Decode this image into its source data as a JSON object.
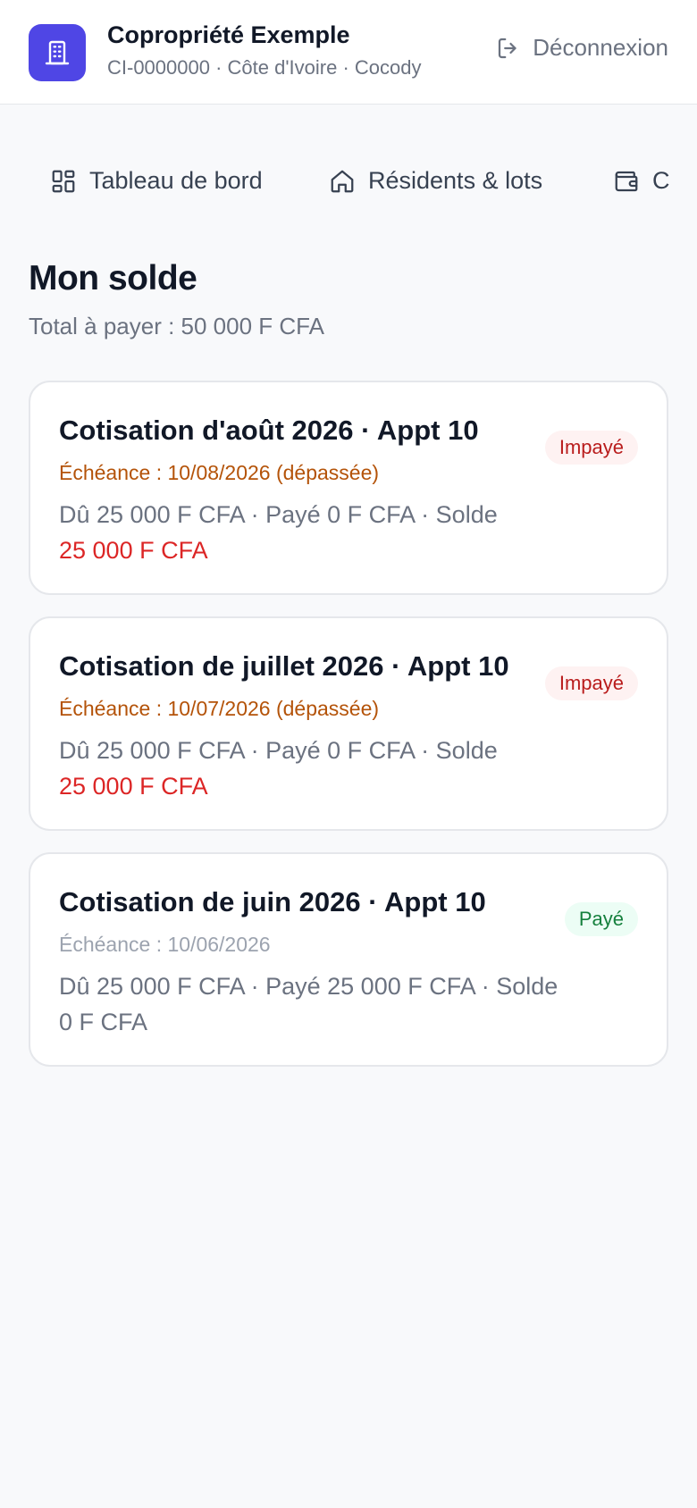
{
  "header": {
    "org_name": "Copropriété Exemple",
    "org_sub": "CI-0000000 · Côte d'Ivoire · Cocody",
    "logo_icon": "building-icon",
    "logout_label": "Déconnexion",
    "accent": "#4f46e5"
  },
  "nav": {
    "items": [
      {
        "label": "Tableau de bord",
        "icon": "dashboard-icon"
      },
      {
        "label": "Résidents & lots",
        "icon": "home-icon"
      },
      {
        "label": "C",
        "icon": "wallet-icon"
      }
    ]
  },
  "page": {
    "title": "Mon solde",
    "subtitle": "Total à payer : 50 000 F CFA"
  },
  "cards": [
    {
      "title": "Cotisation d'août 2026 · Appt 10",
      "due": "Échéance : 10/08/2026 (dépassée)",
      "amounts": "Dû 25 000 F CFA · Payé 0 F CFA · Solde",
      "balance": "25 000 F CFA",
      "status": "Impayé"
    },
    {
      "title": "Cotisation de juillet 2026 · Appt 10",
      "due": "Échéance : 10/07/2026 (dépassée)",
      "amounts": "Dû 25 000 F CFA · Payé 0 F CFA · Solde",
      "balance": "25 000 F CFA",
      "status": "Impayé"
    },
    {
      "title": "Cotisation de juin 2026 · Appt 10",
      "due": "Échéance : 10/06/2026",
      "amounts": "Dû 25 000 F CFA · Payé 25 000 F CFA · Solde",
      "balance": "0 F CFA",
      "status": "Payé"
    }
  ],
  "colors": {
    "unpaid": "#b91c1c",
    "paid": "#15803d",
    "overdue": "#b45309",
    "balance_due": "#dc2626"
  }
}
